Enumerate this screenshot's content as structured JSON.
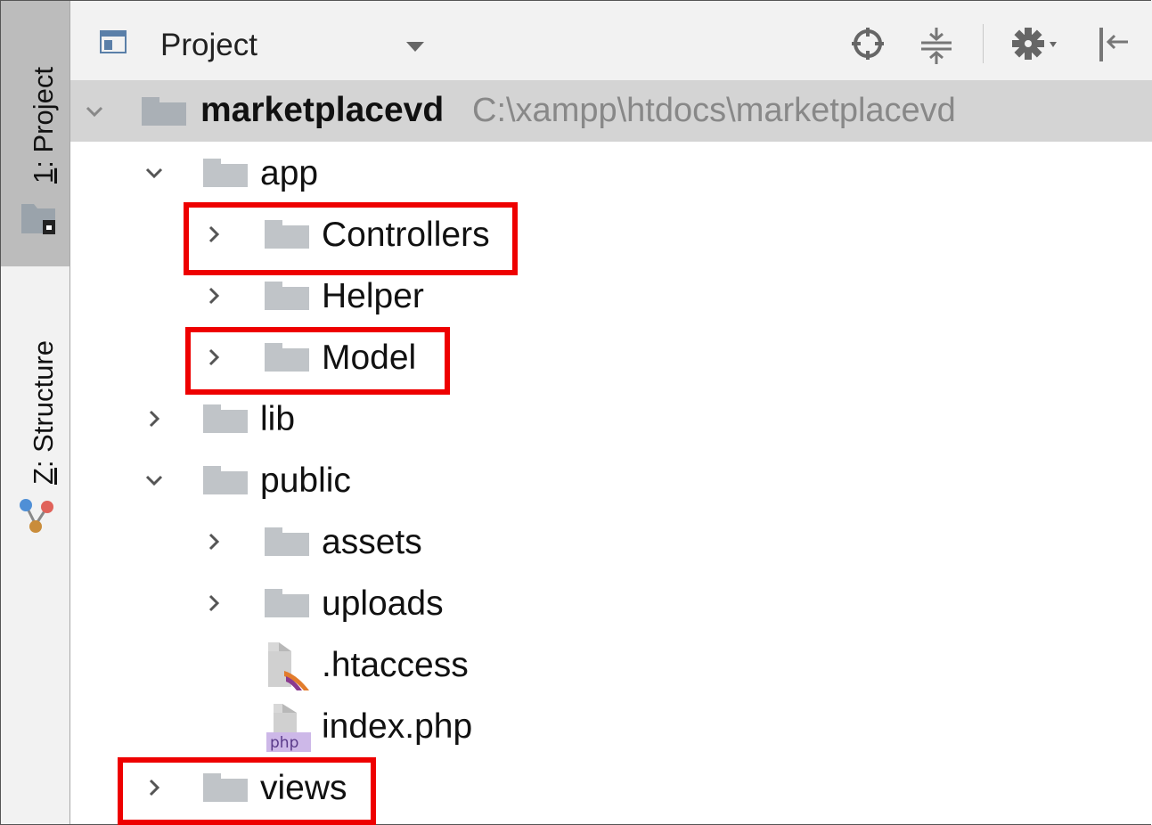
{
  "side_tabs": [
    {
      "label": "1: Project",
      "mnemonic": "1",
      "rest": ": Project",
      "active": true
    },
    {
      "label": "Z: Structure",
      "mnemonic": "Z",
      "rest": ": Structure",
      "active": false
    }
  ],
  "header": {
    "title": "Project",
    "toolbar": [
      "target-icon",
      "collapse-all-icon",
      "settings-icon",
      "hide-panel-icon"
    ]
  },
  "root": {
    "name": "marketplacevd",
    "path": "C:\\xampp\\htdocs\\marketplacevd"
  },
  "tree": [
    {
      "label": "app",
      "type": "folder",
      "expanded": true,
      "depth": 1
    },
    {
      "label": "Controllers",
      "type": "folder",
      "expanded": false,
      "depth": 2,
      "highlighted": true
    },
    {
      "label": "Helper",
      "type": "folder",
      "expanded": false,
      "depth": 2,
      "highlighted": false
    },
    {
      "label": "Model",
      "type": "folder",
      "expanded": false,
      "depth": 2,
      "highlighted": true
    },
    {
      "label": "lib",
      "type": "folder",
      "expanded": false,
      "depth": 1
    },
    {
      "label": "public",
      "type": "folder",
      "expanded": true,
      "depth": 1
    },
    {
      "label": "assets",
      "type": "folder",
      "expanded": false,
      "depth": 2
    },
    {
      "label": "uploads",
      "type": "folder",
      "expanded": false,
      "depth": 2
    },
    {
      "label": ".htaccess",
      "type": "file",
      "icon": "htaccess-file-icon",
      "depth": 2
    },
    {
      "label": "index.php",
      "type": "file",
      "icon": "php-file-icon",
      "badge": "php",
      "depth": 2
    },
    {
      "label": "views",
      "type": "folder",
      "expanded": false,
      "depth": 1,
      "highlighted": true
    }
  ],
  "colors": {
    "highlight": "#ee0000",
    "folder": "#c0c4c8",
    "selected_row": "#d4d4d4",
    "strip_active": "#bcbcbc"
  }
}
